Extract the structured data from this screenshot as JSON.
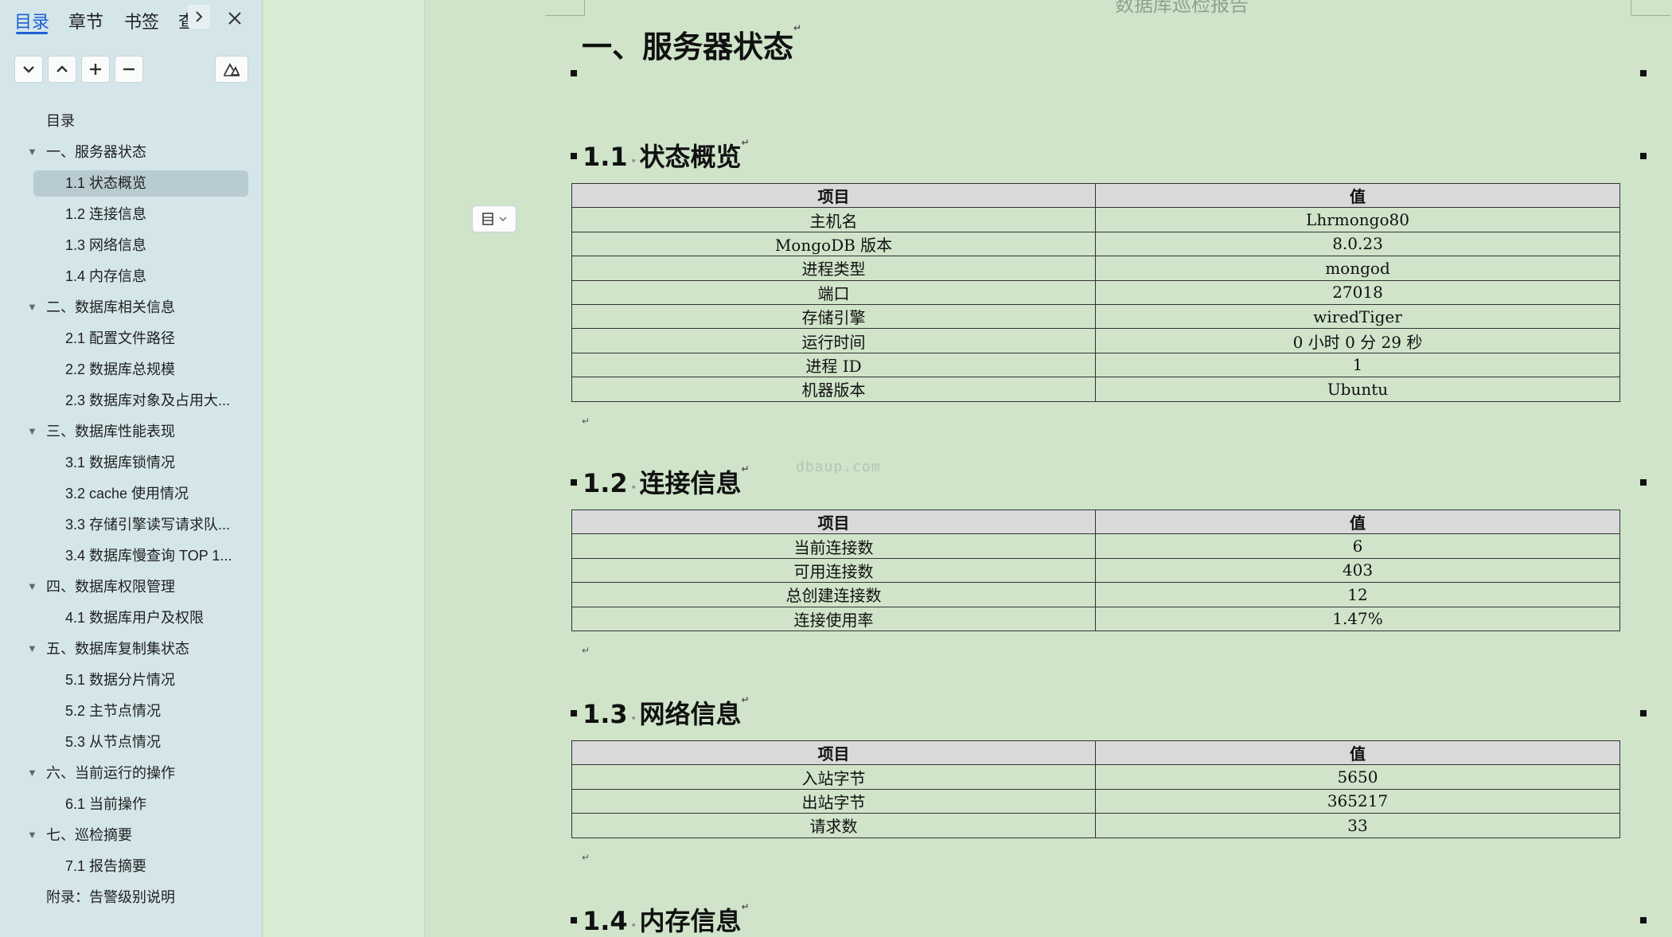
{
  "sidebar": {
    "tabs": [
      {
        "label": "目录",
        "active": true
      },
      {
        "label": "章节"
      },
      {
        "label": "书签"
      },
      {
        "label": "查"
      }
    ],
    "more_icon": "chevron-right-icon",
    "close_icon": "close-icon",
    "tools": [
      "chevron-down-icon",
      "chevron-up-icon",
      "plus-icon",
      "minus-icon",
      "outline-edit-icon"
    ],
    "toc": [
      {
        "label": "目录",
        "level": 0
      },
      {
        "label": "一、服务器状态",
        "level": 1,
        "expanded": true
      },
      {
        "label": "1.1 状态概览",
        "level": 2,
        "selected": true
      },
      {
        "label": "1.2 连接信息",
        "level": 2
      },
      {
        "label": "1.3 网络信息",
        "level": 2
      },
      {
        "label": "1.4 内存信息",
        "level": 2
      },
      {
        "label": "二、数据库相关信息",
        "level": 1,
        "expanded": true
      },
      {
        "label": "2.1 配置文件路径",
        "level": 2
      },
      {
        "label": "2.2 数据库总规模",
        "level": 2
      },
      {
        "label": "2.3 数据库对象及占用大...",
        "level": 2
      },
      {
        "label": "三、数据库性能表现",
        "level": 1,
        "expanded": true
      },
      {
        "label": "3.1 数据库锁情况",
        "level": 2
      },
      {
        "label": "3.2 cache 使用情况",
        "level": 2
      },
      {
        "label": "3.3 存储引擎读写请求队...",
        "level": 2
      },
      {
        "label": "3.4 数据库慢查询 TOP 1...",
        "level": 2
      },
      {
        "label": "四、数据库权限管理",
        "level": 1,
        "expanded": true
      },
      {
        "label": "4.1 数据库用户及权限",
        "level": 2
      },
      {
        "label": "五、数据库复制集状态",
        "level": 1,
        "expanded": true
      },
      {
        "label": "5.1 数据分片情况",
        "level": 2
      },
      {
        "label": "5.2 主节点情况",
        "level": 2
      },
      {
        "label": "5.3 从节点情况",
        "level": 2
      },
      {
        "label": "六、当前运行的操作",
        "level": 1,
        "expanded": true
      },
      {
        "label": "6.1 当前操作",
        "level": 2
      },
      {
        "label": "七、巡检摘要",
        "level": 1,
        "expanded": true
      },
      {
        "label": "7.1 报告摘要",
        "level": 2
      },
      {
        "label": "附录：告警级别说明",
        "level": 0
      }
    ]
  },
  "doc": {
    "header": "数据库巡检报告",
    "h1": "一、服务器状态",
    "watermark": "dbaup.com",
    "sections": [
      {
        "num": "1.1",
        "title": "状态概览",
        "header": [
          "项目",
          "值"
        ],
        "rows": [
          [
            "主机名",
            "Lhrmongo80"
          ],
          [
            "MongoDB 版本",
            "8.0.23"
          ],
          [
            "进程类型",
            "mongod"
          ],
          [
            "端口",
            "27018"
          ],
          [
            "存储引擎",
            "wiredTiger"
          ],
          [
            "运行时间",
            "0 小时 0 分 29 秒"
          ],
          [
            "进程 ID",
            "1"
          ],
          [
            "机器版本",
            "Ubuntu"
          ]
        ]
      },
      {
        "num": "1.2",
        "title": "连接信息",
        "header": [
          "项目",
          "值"
        ],
        "rows": [
          [
            "当前连接数",
            "6"
          ],
          [
            "可用连接数",
            "403"
          ],
          [
            "总创建连接数",
            "12"
          ],
          [
            "连接使用率",
            "1.47%"
          ]
        ]
      },
      {
        "num": "1.3",
        "title": "网络信息",
        "header": [
          "项目",
          "值"
        ],
        "rows": [
          [
            "入站字节",
            "5650"
          ],
          [
            "出站字节",
            "365217"
          ],
          [
            "请求数",
            "33"
          ]
        ]
      },
      {
        "num": "1.4",
        "title": "内存信息"
      }
    ]
  }
}
